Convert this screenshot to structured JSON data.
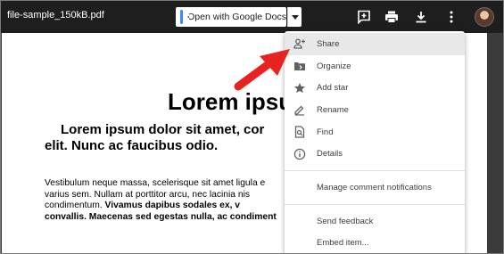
{
  "topbar": {
    "filename": "file-sample_150kB.pdf",
    "open_with_label": "Open with Google Docs",
    "icons": [
      "add-comment-icon",
      "print-icon",
      "download-icon",
      "more-vert-icon"
    ]
  },
  "document": {
    "title": "Lorem ipsu",
    "subtitle_line1": "Lorem ipsum dolor sit amet, cor",
    "subtitle_line2": "elit. Nunc ac faucibus odio.",
    "body_line1": "Vestibulum neque massa, scelerisque sit amet ligula e",
    "body_line2": "varius sem. Nullam at porttitor arcu, nec lacinia nis",
    "body_line3_a": "condimentum. ",
    "body_line3_b": "Vivamus dapibus sodales ex, v",
    "body_line4": "convallis. Maecenas sed egestas nulla, ac condiment"
  },
  "menu": {
    "items": [
      {
        "label": "Share",
        "icon": "person-add-icon"
      },
      {
        "label": "Organize",
        "icon": "folder-move-icon"
      },
      {
        "label": "Add star",
        "icon": "star-icon"
      },
      {
        "label": "Rename",
        "icon": "edit-icon"
      },
      {
        "label": "Find",
        "icon": "find-in-page-icon"
      },
      {
        "label": "Details",
        "icon": "info-icon"
      }
    ],
    "manage_notifications": "Manage comment notifications",
    "send_feedback": "Send feedback",
    "embed_item": "Embed item..."
  },
  "colors": {
    "topbar_bg": "#1e1e1e",
    "viewer_bg": "#3b3b3b",
    "docs_blue": "#4285f4",
    "arrow_red": "#e8231f",
    "menu_hover": "#e8e8e8"
  }
}
